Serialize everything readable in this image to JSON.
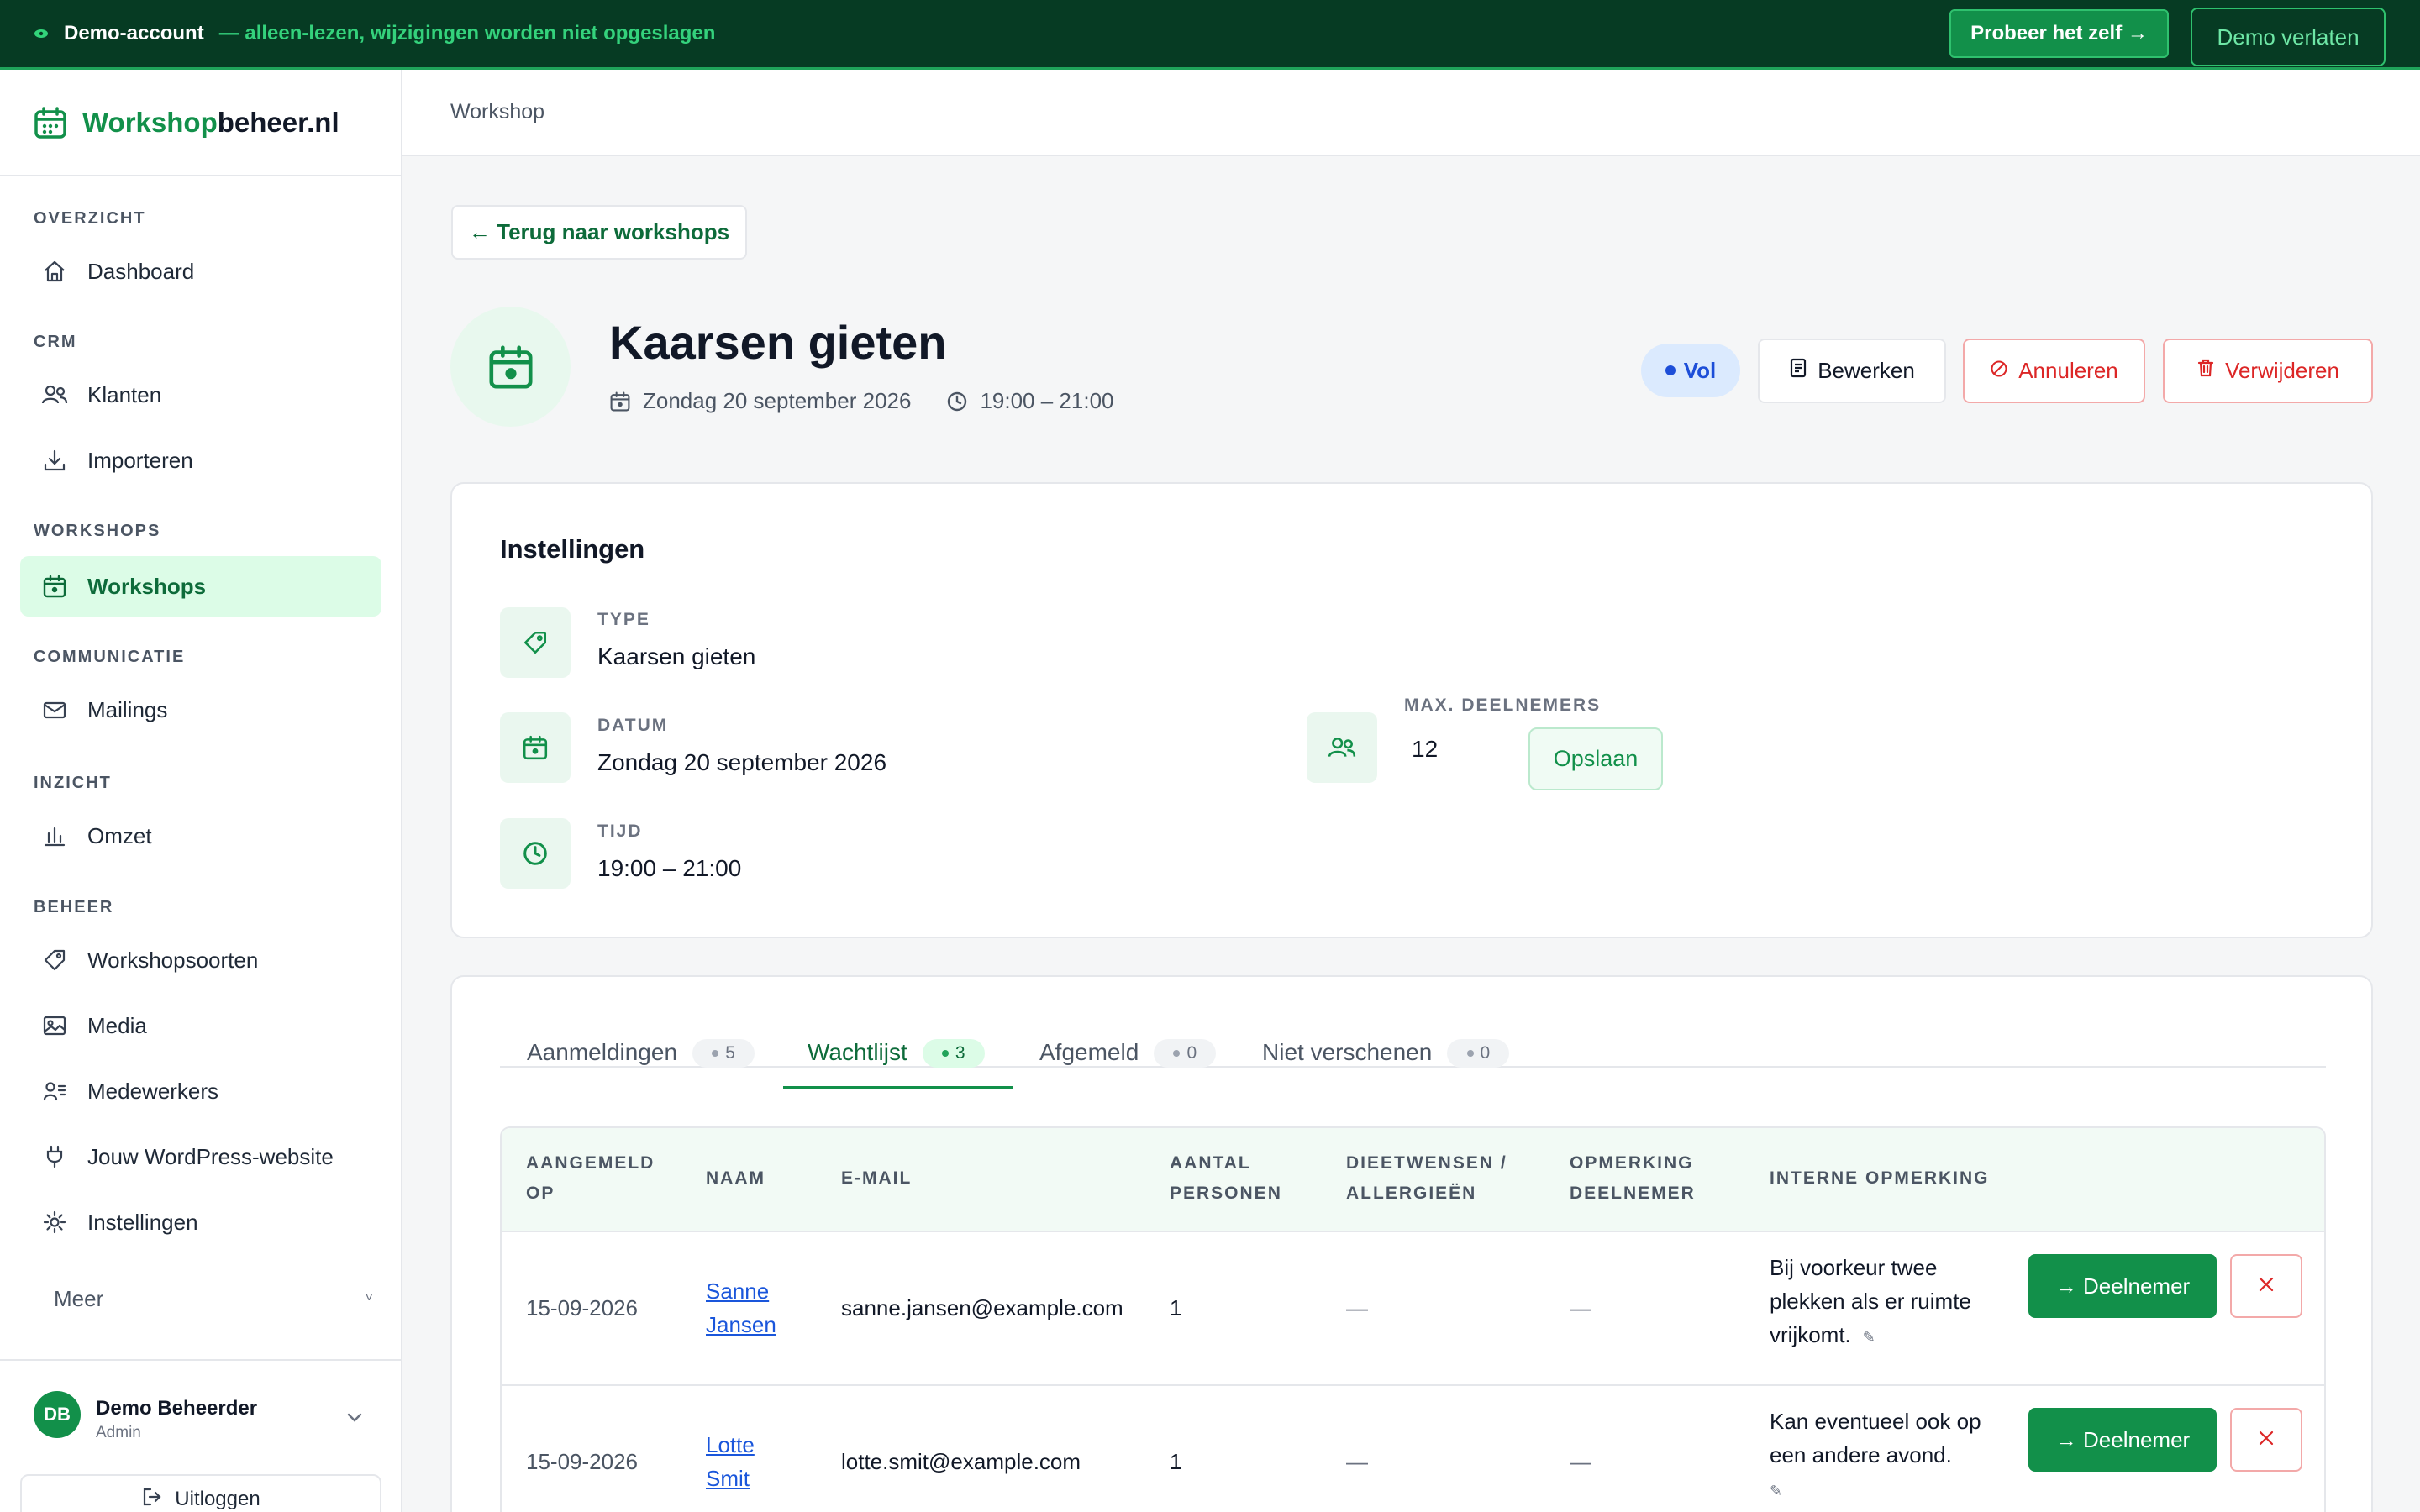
{
  "banner": {
    "account": "Demo-account",
    "note": "— alleen-lezen, wijzigingen worden niet opgeslagen",
    "try_label": "Probeer het zelf →",
    "leave_label": "Demo verlaten"
  },
  "brand": {
    "part1": "Workshop",
    "part2": "beheer.nl"
  },
  "sidebar": {
    "sections": [
      {
        "title": "OVERZICHT",
        "items": [
          {
            "label": "Dashboard",
            "icon": "home-icon"
          }
        ]
      },
      {
        "title": "CRM",
        "items": [
          {
            "label": "Klanten",
            "icon": "users-icon"
          },
          {
            "label": "Importeren",
            "icon": "download-icon"
          }
        ]
      },
      {
        "title": "WORKSHOPS",
        "items": [
          {
            "label": "Workshops",
            "icon": "calendar-icon",
            "active": true
          }
        ]
      },
      {
        "title": "COMMUNICATIE",
        "items": [
          {
            "label": "Mailings",
            "icon": "mail-icon"
          }
        ]
      },
      {
        "title": "INZICHT",
        "items": [
          {
            "label": "Omzet",
            "icon": "bar-chart-icon"
          }
        ]
      },
      {
        "title": "BEHEER",
        "items": [
          {
            "label": "Workshopsoorten",
            "icon": "tag-icon"
          },
          {
            "label": "Media",
            "icon": "image-icon"
          },
          {
            "label": "Medewerkers",
            "icon": "staff-icon"
          },
          {
            "label": "Jouw WordPress-website",
            "icon": "plug-icon"
          },
          {
            "label": "Instellingen",
            "icon": "gear-icon"
          }
        ]
      }
    ],
    "more_label": "Meer",
    "more_chevron": "˅",
    "user": {
      "initials": "DB",
      "name": "Demo Beheerder",
      "role": "Admin"
    },
    "logout_label": "Uitloggen"
  },
  "topbar": {
    "breadcrumb": "Workshop"
  },
  "back_label": "← Terug naar workshops",
  "workshop": {
    "title": "Kaarsen gieten",
    "date": "Zondag 20 september 2026",
    "time": "19:00 – 21:00",
    "status": "Vol",
    "edit_label": "Bewerken",
    "cancel_label": "Annuleren",
    "delete_label": "Verwijderen"
  },
  "settings": {
    "title": "Instellingen",
    "type_label": "TYPE",
    "type_value": "Kaarsen gieten",
    "date_label": "DATUM",
    "date_value": "Zondag 20 september 2026",
    "time_label": "TIJD",
    "time_value": "19:00 – 21:00",
    "max_label": "MAX. DEELNEMERS",
    "max_value": "12",
    "save_label": "Opslaan"
  },
  "tabs": [
    {
      "label": "Aanmeldingen",
      "count": "5"
    },
    {
      "label": "Wachtlijst",
      "count": "3",
      "active": true
    },
    {
      "label": "Afgemeld",
      "count": "0"
    },
    {
      "label": "Niet verschenen",
      "count": "0"
    }
  ],
  "table": {
    "headers": {
      "registered_on": [
        "AANGEMELD",
        "OP"
      ],
      "name": "NAAM",
      "email": "E-MAIL",
      "persons": [
        "AANTAL",
        "PERSONEN"
      ],
      "diet": [
        "DIEETWENSEN /",
        "ALLERGIEËN"
      ],
      "remark": [
        "OPMERKING",
        "DEELNEMER"
      ],
      "internal": "INTERNE OPMERKING"
    },
    "rows": [
      {
        "date": "15-09-2026",
        "first": "Sanne",
        "last": "Jansen",
        "email": "sanne.jansen@example.com",
        "persons": "1",
        "diet": "—",
        "remark": "—",
        "internal": [
          "Bij voorkeur twee",
          "plekken als er ruimte",
          "vrijkomt."
        ],
        "promote_label": "→ Deelnemer"
      },
      {
        "date": "15-09-2026",
        "first": "Lotte",
        "last": "Smit",
        "email": "lotte.smit@example.com",
        "persons": "1",
        "diet": "—",
        "remark": "—",
        "internal": [
          "Kan eventueel ook op",
          "een andere avond."
        ],
        "promote_label": "→ Deelnemer"
      }
    ]
  },
  "colors": {
    "brand": "#12904a",
    "banner": "#063b23",
    "danger": "#dc2626",
    "status": "#1d4ed8"
  }
}
